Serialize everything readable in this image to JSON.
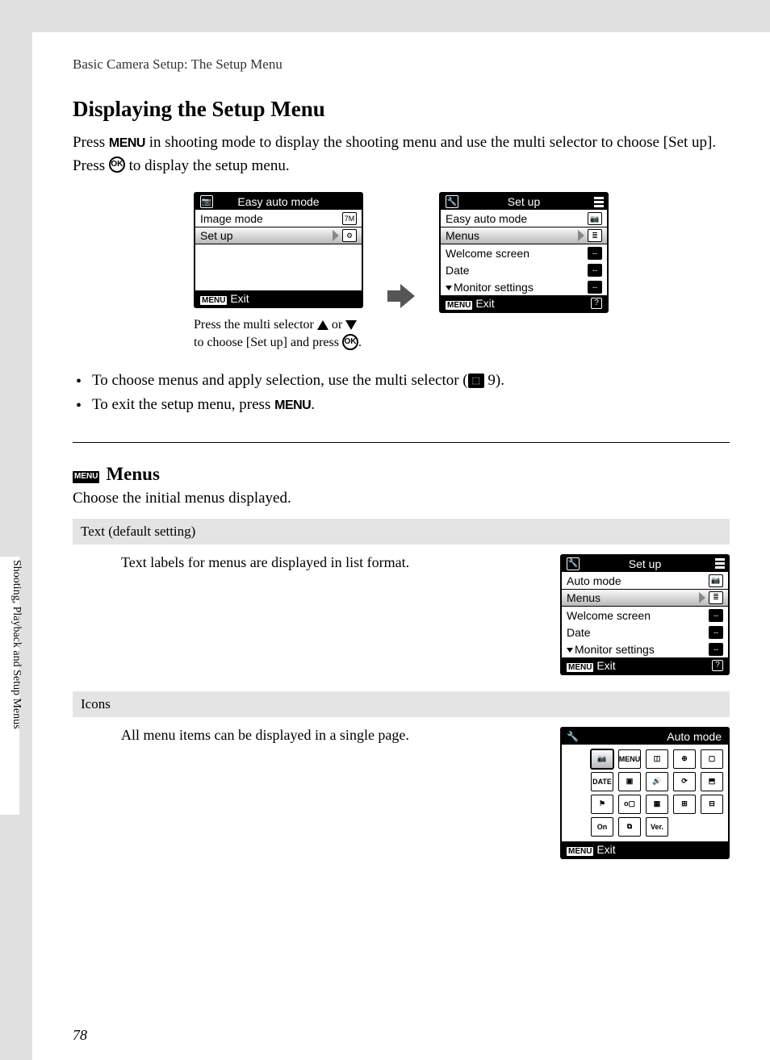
{
  "breadcrumb": "Basic Camera Setup: The Setup Menu",
  "h1": "Displaying the Setup Menu",
  "intro_parts": {
    "p1a": "Press ",
    "menu1": "MENU",
    "p1b": " in shooting mode to display the shooting menu and use the multi selector to choose [Set up]. Press ",
    "ok1": "OK",
    "p1c": " to display the setup menu."
  },
  "screen_left": {
    "title": "Easy auto mode",
    "rows": [
      {
        "label": "Image mode",
        "ri": "7M"
      },
      {
        "label": "Set up",
        "ri": "⚙",
        "sel": true
      }
    ],
    "footer_menu": "MENU",
    "footer_exit": "Exit"
  },
  "screen_right": {
    "title": "Set up",
    "rows": [
      {
        "label": "Easy auto mode",
        "ri": "📷"
      },
      {
        "label": "Menus",
        "ri": "≣",
        "sel": true
      },
      {
        "label": "Welcome screen",
        "ri": "--",
        "dark": true
      },
      {
        "label": "Date",
        "ri": "--",
        "dark": true
      },
      {
        "label": "Monitor settings",
        "ri": "--",
        "dark": true,
        "arrow": true
      }
    ],
    "footer_menu": "MENU",
    "footer_exit": "Exit"
  },
  "caption": {
    "a": "Press the multi selector ",
    "b": " or ",
    "c": " to choose [Set up] and press ",
    "ok": "OK",
    "d": "."
  },
  "bullets": {
    "b1a": "To choose menus and apply selection, use the multi selector (",
    "b1_pageref": " 9).",
    "b2a": "To exit the setup menu, press ",
    "b2_menu": "MENU",
    "b2b": "."
  },
  "menus_section": {
    "icon": "MENU",
    "title": "Menus",
    "desc": "Choose the initial menus displayed."
  },
  "opt_text": {
    "header": "Text (default setting)",
    "body": "Text labels for menus are displayed in list format.",
    "screen": {
      "title": "Set up",
      "rows": [
        {
          "label": "Auto mode",
          "ri": "📷"
        },
        {
          "label": "Menus",
          "ri": "≣",
          "sel": true
        },
        {
          "label": "Welcome screen",
          "ri": "--",
          "dark": true
        },
        {
          "label": "Date",
          "ri": "--",
          "dark": true
        },
        {
          "label": "Monitor settings",
          "ri": "--",
          "dark": true,
          "arrow": true
        }
      ],
      "footer_menu": "MENU",
      "footer_exit": "Exit"
    }
  },
  "opt_icons": {
    "header": "Icons",
    "body": "All menu items can be displayed in a single page.",
    "screen": {
      "title": "Auto mode",
      "grid": [
        {
          "t": "📷",
          "sel": true
        },
        {
          "t": "MENU"
        },
        {
          "t": "◫"
        },
        {
          "t": "⊕"
        },
        {
          "t": "▢"
        },
        {
          "t": "DATE"
        },
        {
          "t": "▣"
        },
        {
          "t": "🔊"
        },
        {
          "t": "⟳"
        },
        {
          "t": "⬒"
        },
        {
          "t": "⚑"
        },
        {
          "t": "o▢"
        },
        {
          "t": "▦"
        },
        {
          "t": "⊞"
        },
        {
          "t": "⊟"
        },
        {
          "t": "On"
        },
        {
          "t": "⧉"
        },
        {
          "t": "Ver."
        },
        {
          "t": "",
          "empty": true
        },
        {
          "t": "",
          "empty": true
        }
      ],
      "footer_menu": "MENU",
      "footer_exit": "Exit"
    }
  },
  "side_text": "Shooting, Playback and Setup Menus",
  "page_number": "78"
}
